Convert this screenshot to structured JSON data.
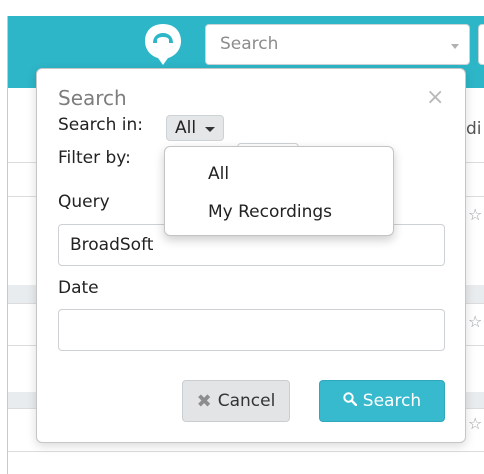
{
  "header": {
    "search_placeholder": "Search",
    "logo_icon": "speech-bubble-phone-icon"
  },
  "background": {
    "partial_column_text": "di",
    "star_icon": "star-outline-icon"
  },
  "modal": {
    "title": "Search",
    "close_glyph": "×",
    "search_in_label": "Search in:",
    "scope_value": "All",
    "filter_by_label": "Filter by:",
    "query_label": "Query",
    "query_value": "BroadSoft",
    "date_label": "Date",
    "date_value": "",
    "cancel_label": "Cancel",
    "search_label": "Search"
  },
  "scope_menu": {
    "items": [
      "All",
      "My Recordings"
    ]
  },
  "colors": {
    "accent": "#2db6c8",
    "search_button": "#37b9ce"
  }
}
